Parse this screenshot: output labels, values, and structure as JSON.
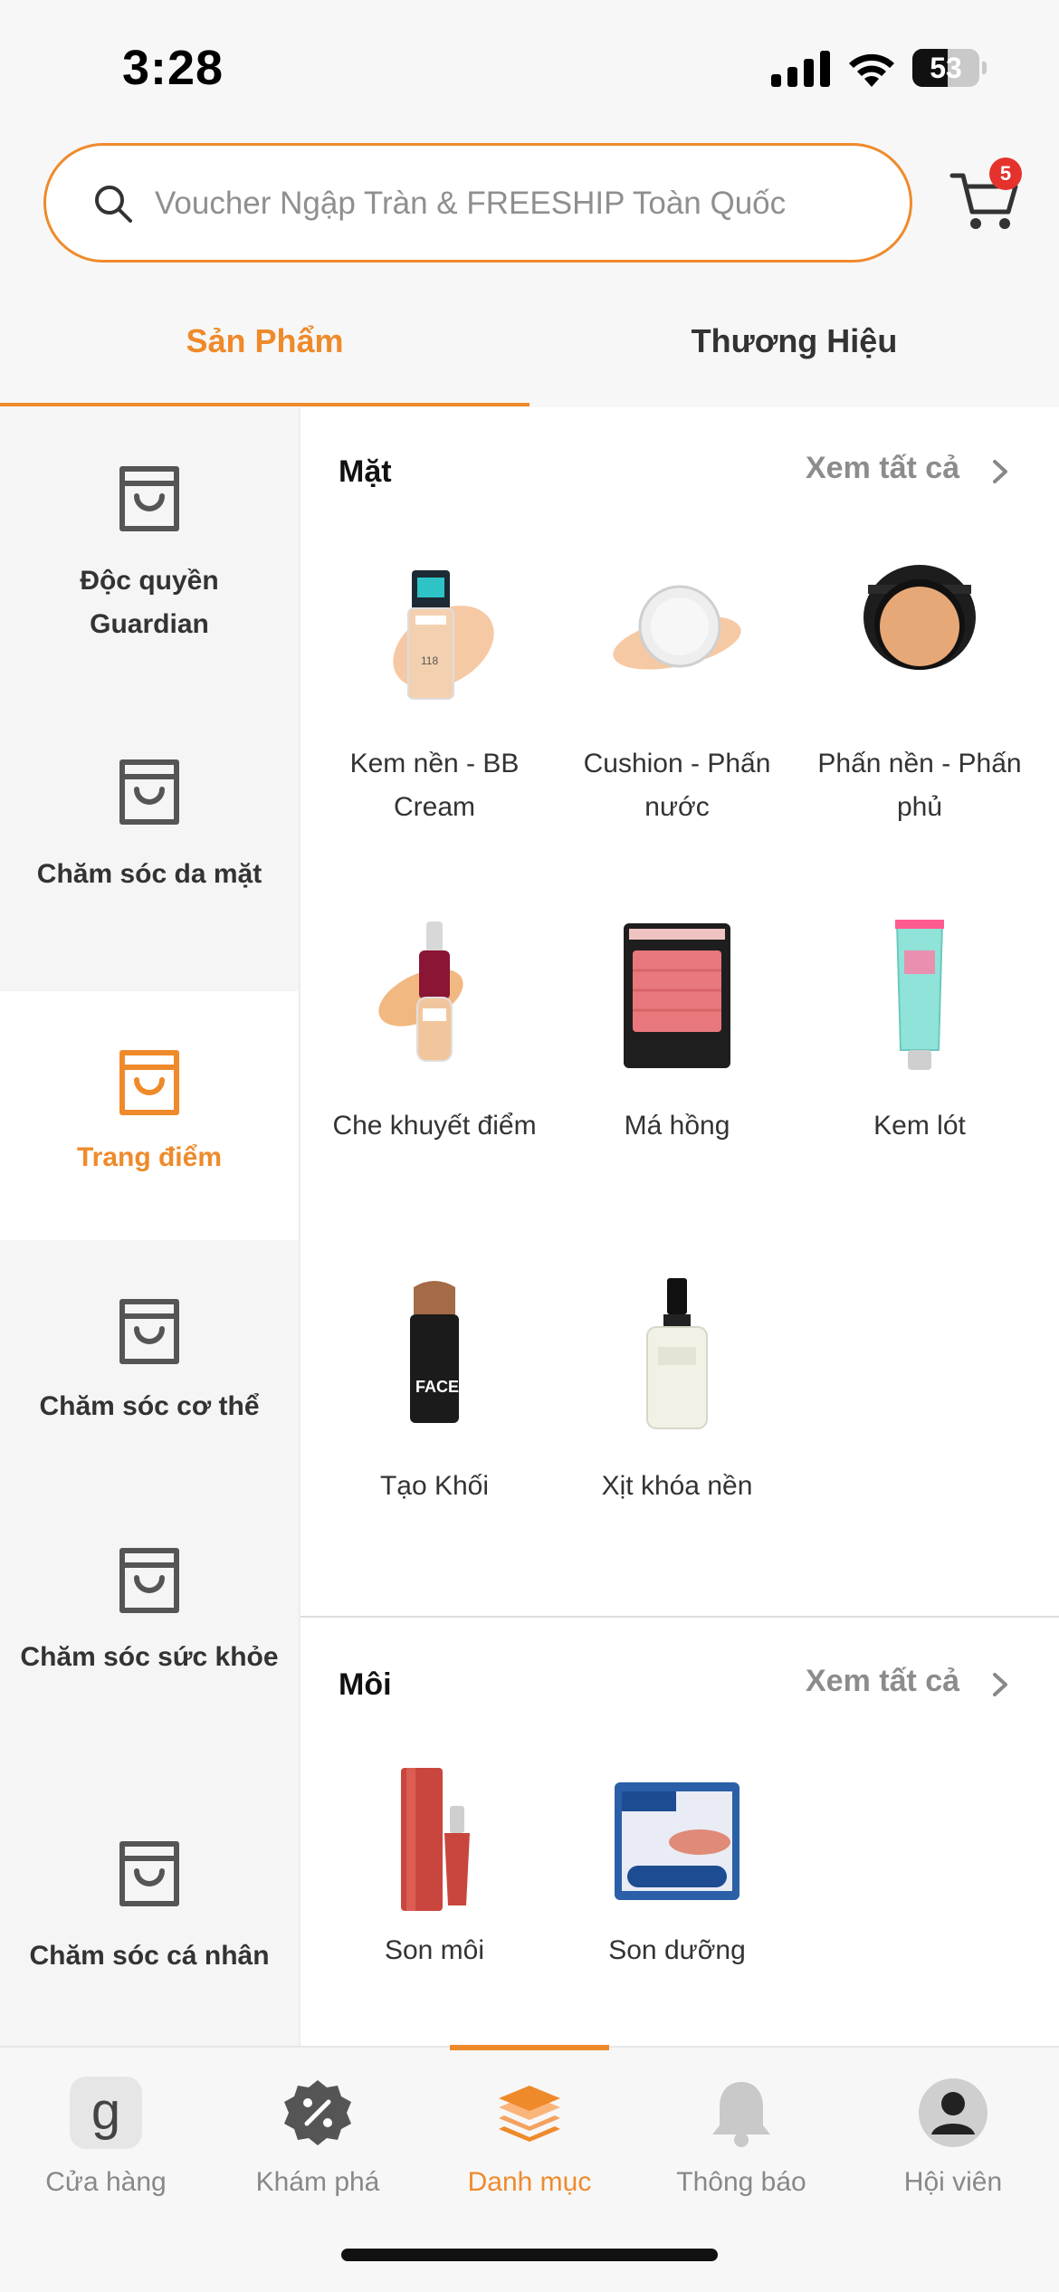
{
  "status_bar": {
    "time": "3:28",
    "battery": "53",
    "battery_level": 0.53
  },
  "search": {
    "placeholder": "Voucher Ngập Tràn & FREESHIP Toàn Quốc"
  },
  "cart": {
    "badge_count": "5"
  },
  "tabs": [
    {
      "label": "Sản Phẩm",
      "active": true
    },
    {
      "label": "Thương Hiệu",
      "active": false
    }
  ],
  "sidebar": {
    "items": [
      {
        "label": "Độc quyền Guardian",
        "active": false
      },
      {
        "label": "Chăm sóc da mặt",
        "active": false
      },
      {
        "label": "Trang điểm",
        "active": true
      },
      {
        "label": "Chăm sóc cơ thể",
        "active": false
      },
      {
        "label": "Chăm sóc sức khỏe",
        "active": false
      },
      {
        "label": "Chăm sóc cá nhân",
        "active": false
      }
    ]
  },
  "sections": [
    {
      "title": "Mặt",
      "see_all": "Xem tất cả",
      "products": [
        {
          "label": "Kem nền - BB Cream",
          "icon": "foundation-bottle-icon"
        },
        {
          "label": "Cushion - Phấn nước",
          "icon": "cushion-compact-icon"
        },
        {
          "label": "Phấn nền - Phấn phủ",
          "icon": "powder-compact-icon"
        },
        {
          "label": "Che khuyết điểm",
          "icon": "concealer-icon"
        },
        {
          "label": "Má hồng",
          "icon": "blush-palette-icon"
        },
        {
          "label": "Kem lót",
          "icon": "primer-tube-icon"
        },
        {
          "label": "Tạo Khối",
          "icon": "contour-stick-icon"
        },
        {
          "label": "Xịt khóa nền",
          "icon": "setting-spray-icon"
        }
      ]
    },
    {
      "title": "Môi",
      "see_all": "Xem tất cả",
      "products": [
        {
          "label": "Son môi",
          "icon": "lipstick-icon"
        },
        {
          "label": "Son dưỡng",
          "icon": "lip-balm-icon"
        }
      ]
    }
  ],
  "bottom_nav": {
    "items": [
      {
        "label": "Cửa hàng",
        "icon": "store-g-icon",
        "active": false
      },
      {
        "label": "Khám phá",
        "icon": "discount-badge-icon",
        "active": false
      },
      {
        "label": "Danh mục",
        "icon": "layers-icon",
        "active": true
      },
      {
        "label": "Thông báo",
        "icon": "bell-icon",
        "active": false
      },
      {
        "label": "Hội viên",
        "icon": "user-icon",
        "active": false
      }
    ]
  },
  "colors": {
    "accent": "#ef8a2b",
    "badge": "#e5322d",
    "sidebar_bg": "#f5f5f5",
    "text": "#333333"
  }
}
